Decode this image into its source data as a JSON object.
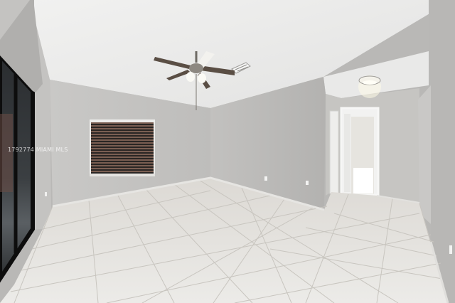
{
  "watermark": {
    "text": "1792774 MIAMI MLS"
  },
  "colors": {
    "ceiling": "#ebebea",
    "wall_left": "#c8c7c5",
    "wall_back": "#c4c3c1",
    "wall_right": "#b7b6b4",
    "floor": "#e3e1dd",
    "grout": "#c9c6c0",
    "door_frame": "#111111",
    "light_glow": "#fffbe8"
  }
}
